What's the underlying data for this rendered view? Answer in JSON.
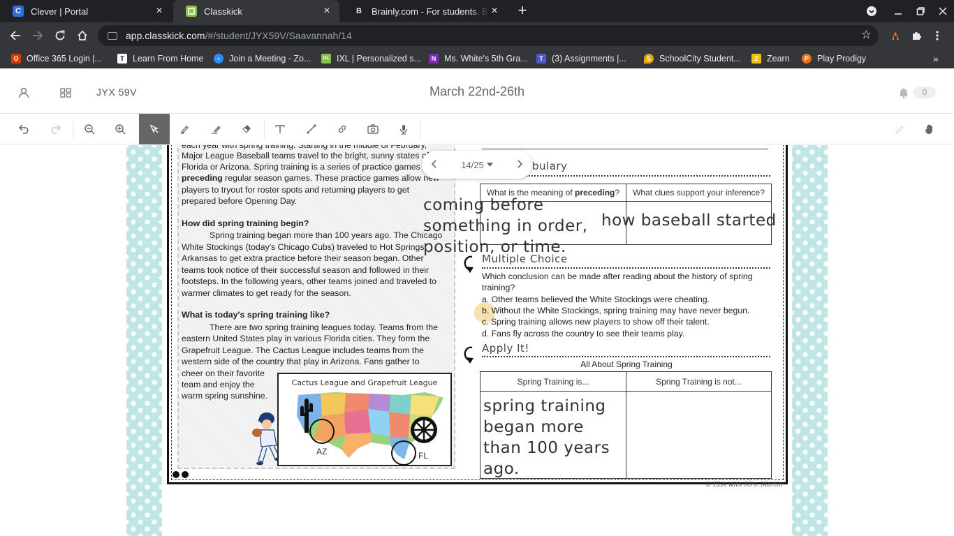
{
  "browser": {
    "tabs": [
      {
        "title": "Clever | Portal",
        "favicon": "C",
        "favicon_color": "#2f6fe4",
        "active": false
      },
      {
        "title": "Classkick",
        "favicon": "K",
        "favicon_color": "#8bc34a",
        "active": true
      },
      {
        "title": "Brainly.com - For students. By st",
        "favicon": "B",
        "favicon_color": "#202124",
        "active": false
      }
    ],
    "url_host": "app.classkick.com",
    "url_path": "/#/student/JYX59V/Saavannah/14",
    "bookmarks": [
      {
        "label": "Office 365 Login |...",
        "color": "#d83b01",
        "glyph": "O"
      },
      {
        "label": "Learn From Home",
        "color": "#111111",
        "glyph": "T"
      },
      {
        "label": "Join a Meeting - Zo...",
        "color": "#2d8cff",
        "glyph": "Z"
      },
      {
        "label": "IXL | Personalized s...",
        "color": "#8bc34a",
        "glyph": "IXL"
      },
      {
        "label": "Ms. White's 5th Gra...",
        "color": "#7b2bbf",
        "glyph": "N"
      },
      {
        "label": "(3) Assignments |...",
        "color": "#5059c9",
        "glyph": "T"
      },
      {
        "label": "SchoolCity Student...",
        "color": "#e6a800",
        "glyph": "S"
      },
      {
        "label": "Zearn",
        "color": "#f2c200",
        "glyph": "Z"
      },
      {
        "label": "Play Prodigy",
        "color": "#e8711a",
        "glyph": "P"
      }
    ]
  },
  "header": {
    "class_code": "JYX 59V",
    "title": "March 22nd-26th",
    "notification_count": "0"
  },
  "pager": {
    "current": "14/25"
  },
  "worksheet": {
    "p1_lines": [
      "each year with spring training. Starting in the middle of February,",
      "Major League Baseball teams travel to the bright, sunny states of",
      "Florida or Arizona. Spring training is a series of practice games"
    ],
    "p1_bold_word": "preceding",
    "p1_line4_rest": " regular season games. These practice games allow new",
    "p1_lines_end": [
      "players to tryout for roster spots and returning players to get",
      "prepared before Opening Day."
    ],
    "heading2": "How did spring training begin?",
    "p2_lines": [
      "Spring training began more than 100 years ago. The Chicago",
      "White Stockings (today's Chicago Cubs) traveled to Hot Springs,",
      "Arkansas to get extra practice before their season began. Other",
      "teams took notice of their successful season and followed in their",
      "footsteps. In the following years, other teams joined and traveled to",
      "warmer climates to get ready for the season."
    ],
    "heading3": "What is today's spring training like?",
    "p3_lines": [
      "There are two spring training leagues today. Teams from the",
      "eastern United States play in various Florida cities. They form the",
      "Grapefruit League. The Cactus League includes teams from the",
      "western side of the country that play in Arizona. Fans gather to"
    ],
    "p3_short_lines": [
      "cheer on their favorite",
      "team and enjoy the",
      "warm spring sunshine."
    ],
    "map_title": "Cactus League and Grapefruit League",
    "map_label_az": "AZ",
    "map_label_fl": "FL",
    "vocab_title": "bulary",
    "vocab_q_prefix": "What is the meaning of ",
    "vocab_q_bold": "preceding",
    "vocab_q_suffix": "?",
    "vocab_clues_header": "What clues support your inference?",
    "mc_title": "Multiple Choice",
    "mc_question_lines": [
      "Which conclusion can be made after reading about the history of spring",
      "training?"
    ],
    "mc_options": [
      "a. Other teams believed the White Stockings were cheating.",
      "b. Without the White Stockings, spring training may have never begun.",
      "c. Spring training allows new players to show off their talent.",
      "d. Fans fly across the country to see their teams play."
    ],
    "apply_title": "Apply It!",
    "apply_caption": "All About Spring Training",
    "apply_col1": "Spring Training is...",
    "apply_col2": "Spring Training is not...",
    "copyright": "© ELA with Mrs. Martin"
  },
  "student_answers": {
    "meaning": [
      "coming before",
      "something in order,",
      "position, or time."
    ],
    "clues": "how baseball started",
    "spring_is": [
      "spring training",
      "began more",
      "than 100 years",
      "ago."
    ]
  }
}
